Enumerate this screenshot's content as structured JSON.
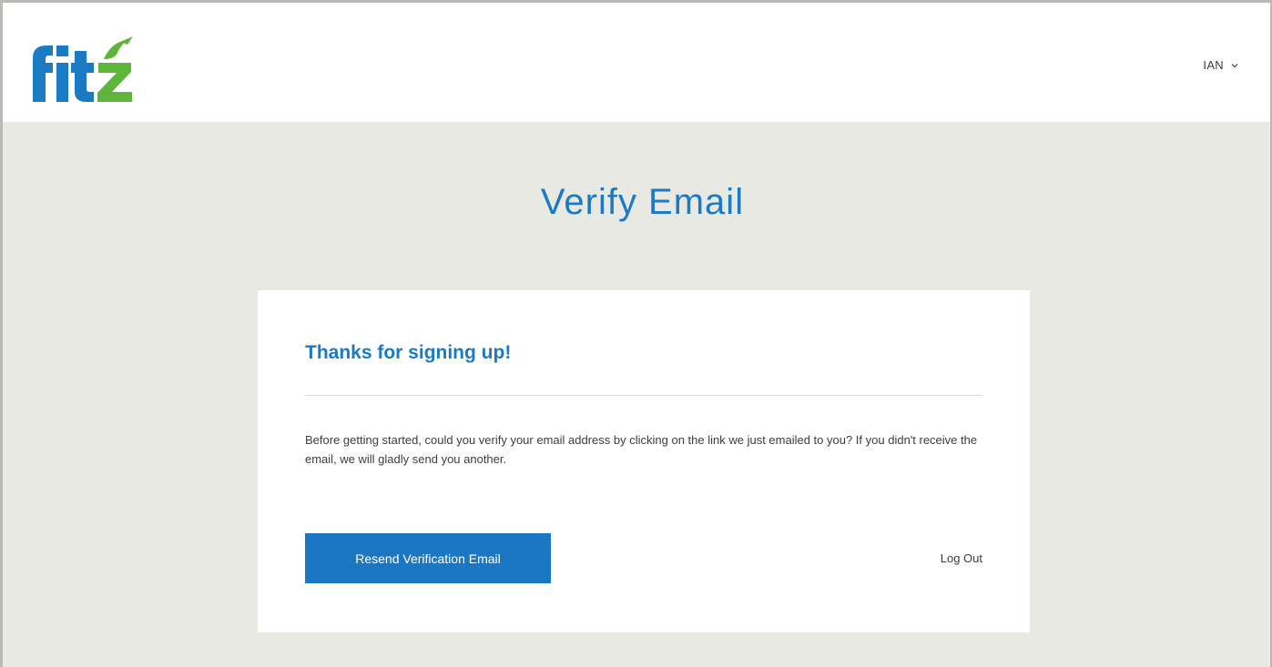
{
  "header": {
    "logo_text": "fitz",
    "user_name": "IAN"
  },
  "main": {
    "page_title": "Verify Email",
    "card": {
      "heading": "Thanks for signing up!",
      "body": "Before getting started, could you verify your email address by clicking on the link we just emailed to you? If you didn't receive the email, we will gladly send you another.",
      "resend_button_label": "Resend Verification Email",
      "logout_label": "Log Out"
    }
  },
  "colors": {
    "brand_blue": "#1a7ac4",
    "brand_green": "#5fb53c",
    "background": "#e9e9e4",
    "button": "#1c77c3"
  }
}
